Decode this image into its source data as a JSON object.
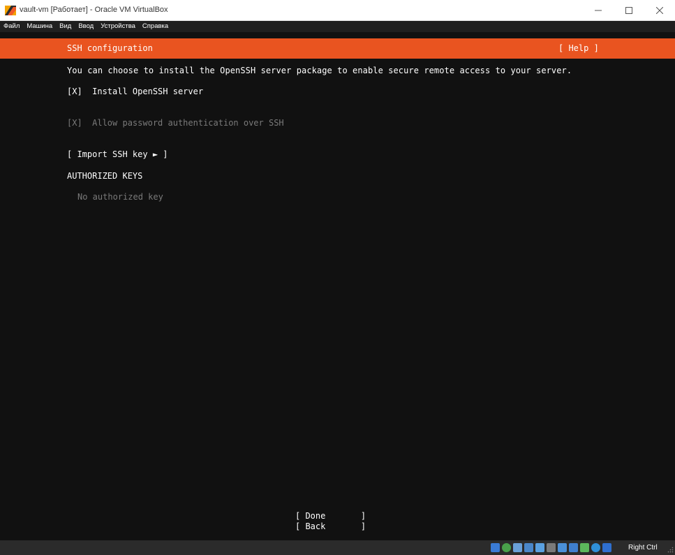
{
  "window": {
    "title": "vault-vm [Работает] - Oracle VM VirtualBox",
    "icon": "virtualbox-icon",
    "controls": [
      "minimize-icon",
      "maximize-icon",
      "close-icon"
    ]
  },
  "menu": {
    "items": [
      {
        "label": "Файл"
      },
      {
        "label": "Машина"
      },
      {
        "label": "Вид"
      },
      {
        "label": "Ввод"
      },
      {
        "label": "Устройства"
      },
      {
        "label": "Справка"
      }
    ]
  },
  "installer": {
    "title": "SSH configuration",
    "help": "[ Help ]",
    "intro": "You can choose to install the OpenSSH server package to enable secure remote access to your server.",
    "install_openssh": "[X]  Install OpenSSH server",
    "allow_password": "[X]  Allow password authentication over SSH",
    "import_key": "[ Import SSH key ► ]",
    "authorized_keys_heading": "AUTHORIZED KEYS",
    "no_keys": "No authorized key",
    "done": "[ Done       ]",
    "back": "[ Back       ]",
    "accent_color": "#e95420"
  },
  "status": {
    "host_key": "Right Ctrl",
    "icons": [
      "hard-disk-icon",
      "optical-drive-icon",
      "audio-icon",
      "network-icon",
      "usb-icon",
      "shared-folders-icon",
      "display-icon",
      "recording-icon",
      "cpu-icon",
      "mouse-integration-icon",
      "keyboard-icon"
    ]
  }
}
